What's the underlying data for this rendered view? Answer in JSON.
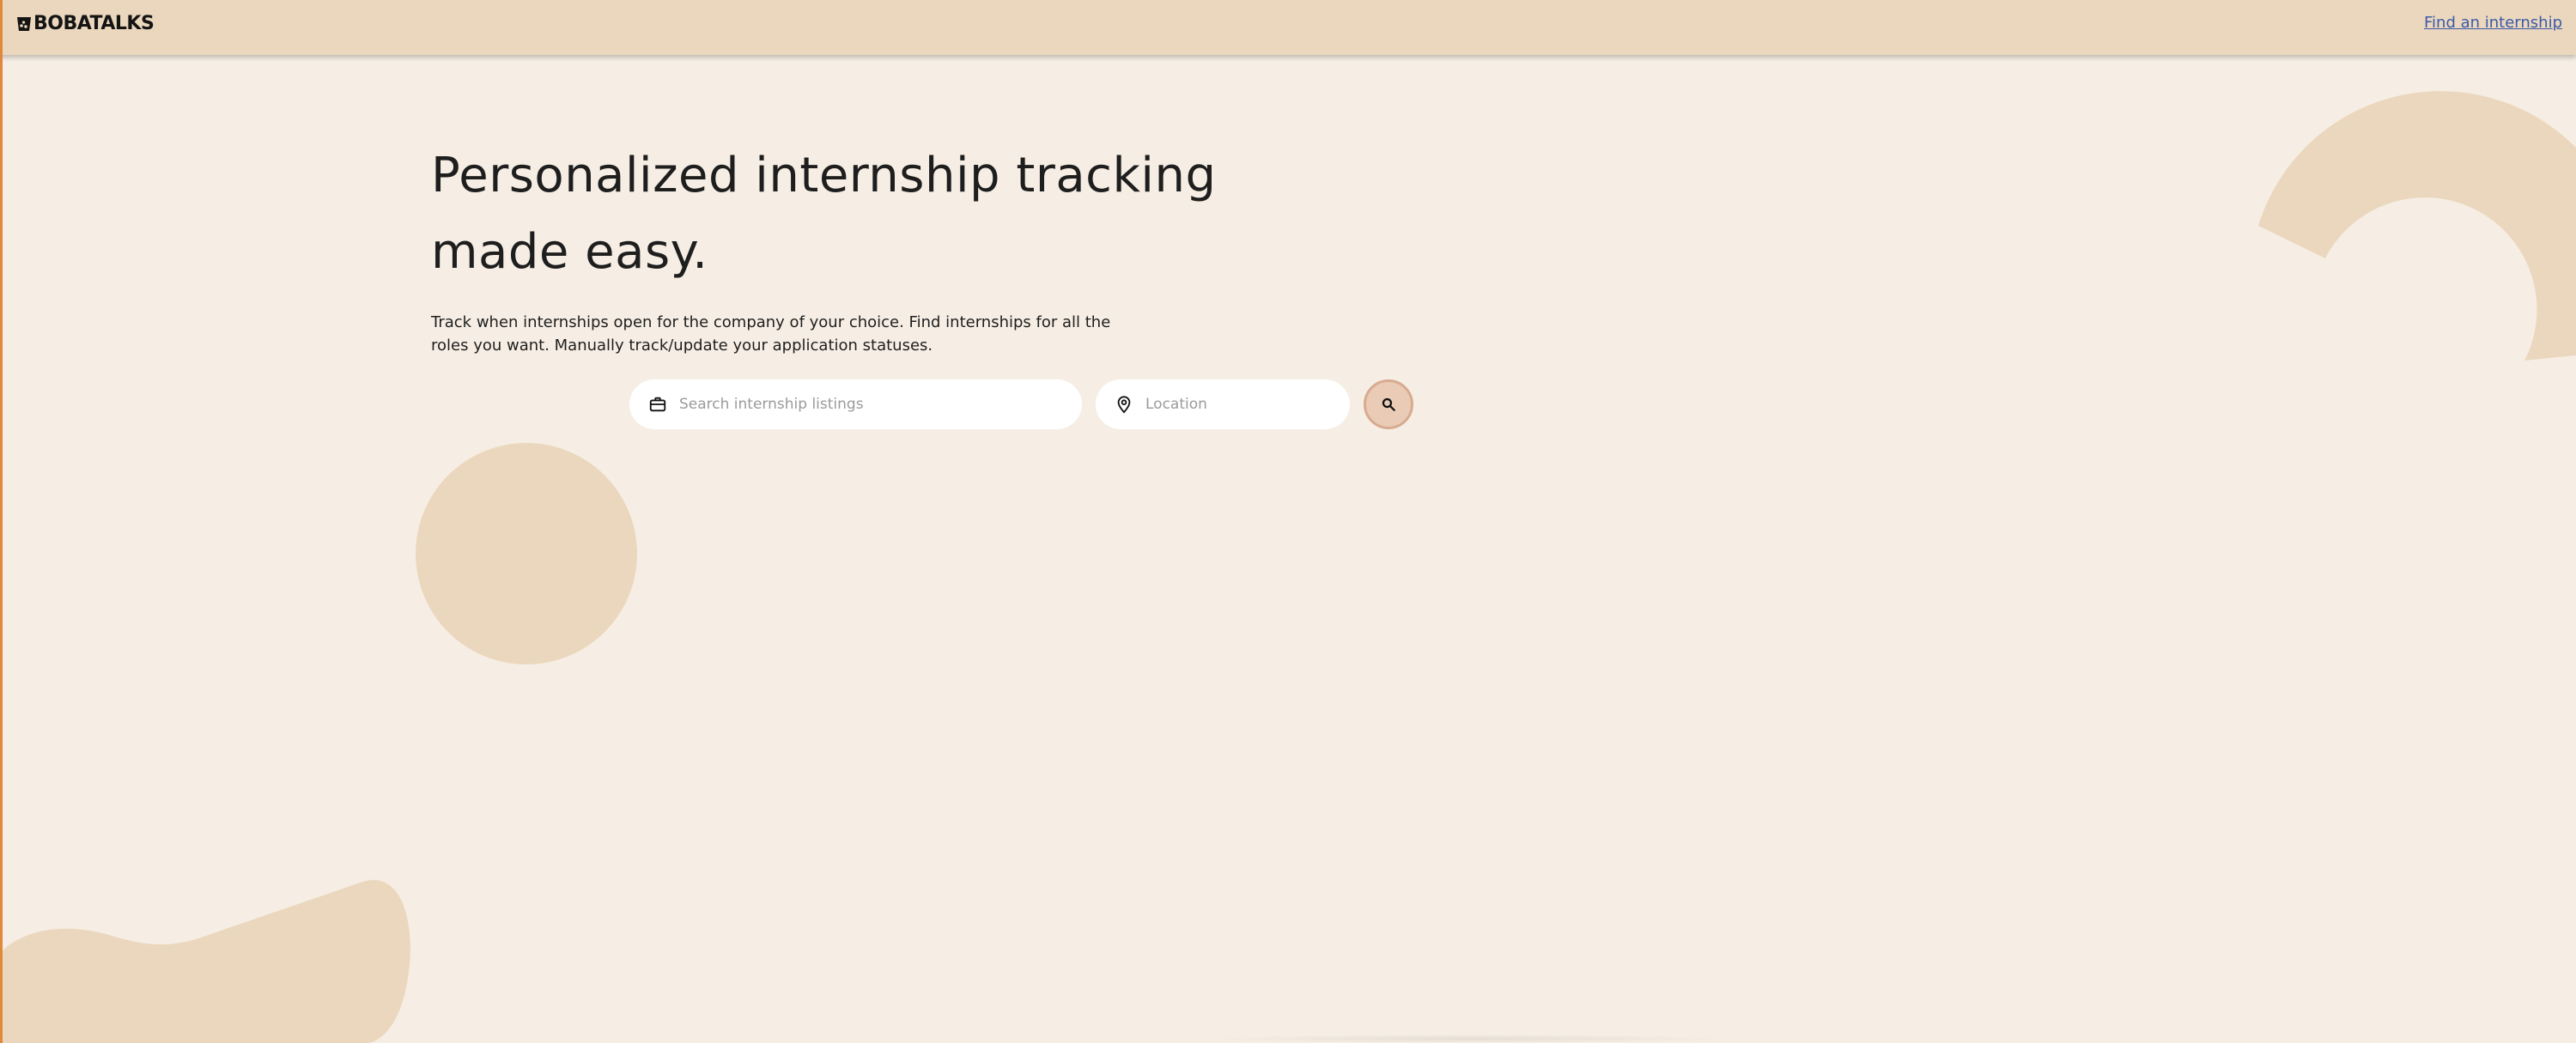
{
  "header": {
    "logo_text": "BOBATALKS",
    "logo_icon": "boba-cup-icon",
    "nav_link_label": "Find an internship"
  },
  "hero": {
    "title": "Personalized internship tracking made easy.",
    "description": "Track when internships open for the company of your choice. Find internships for all the roles you want. Manually track/update your application statuses."
  },
  "search": {
    "keyword_placeholder": "Search internship listings",
    "keyword_value": "",
    "keyword_icon": "briefcase-icon",
    "location_placeholder": "Location",
    "location_value": "",
    "location_icon": "location-pin-icon",
    "submit_icon": "search-icon"
  },
  "colors": {
    "page_background": "#f6eee4",
    "header_background": "#ebd7bd",
    "decorative_shape": "#ebd7bd",
    "link": "#3b5aa8",
    "search_button_fill": "#e9cbb6",
    "search_button_border": "#d8ab91",
    "left_edge_accent": "#e0893a"
  }
}
